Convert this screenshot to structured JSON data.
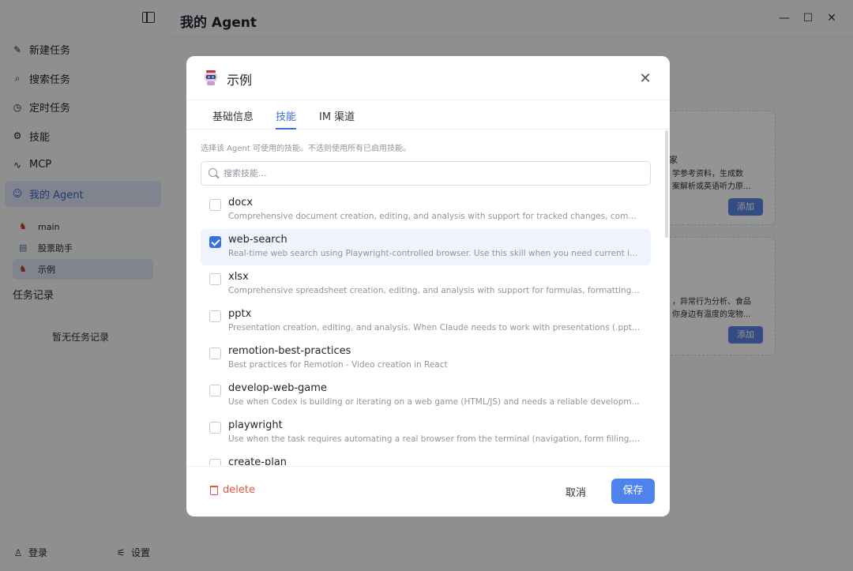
{
  "app": {
    "main_title": "我的 Agent",
    "window_controls": [
      "—",
      "☐",
      "✕"
    ]
  },
  "sidebar": {
    "items": [
      {
        "label": "新建任务",
        "icon": "edit-icon"
      },
      {
        "label": "搜索任务",
        "icon": "search-icon"
      },
      {
        "label": "定时任务",
        "icon": "clock-icon"
      },
      {
        "label": "技能",
        "icon": "puzzle-icon"
      },
      {
        "label": "MCP",
        "icon": "mcp-icon"
      },
      {
        "label": "我的 Agent",
        "icon": "agent-icon",
        "active": true
      }
    ],
    "agents": [
      {
        "label": "main",
        "icon": "lobster-icon"
      },
      {
        "label": "股票助手",
        "icon": "chart-icon"
      },
      {
        "label": "示例",
        "icon": "lobster-icon",
        "active": true
      }
    ],
    "task_section": "任务记录",
    "empty_tasks": "暂无任务记录",
    "login": "登录",
    "settings": "设置"
  },
  "background_cards": [
    {
      "title_fragment": "家",
      "lines": [
        "学参考资料，生成数",
        "案解析或英语听力原..."
      ],
      "button": "添加"
    },
    {
      "lines": [
        "，异常行为分析、食品",
        "你身边有温度的宠物..."
      ],
      "button": "添加"
    }
  ],
  "modal": {
    "title": "示例",
    "tabs": [
      {
        "label": "基础信息"
      },
      {
        "label": "技能",
        "active": true
      },
      {
        "label": "IM 渠道"
      }
    ],
    "hint": "选择该 Agent 可使用的技能。不选则使用所有已启用技能。",
    "search_placeholder": "搜索技能...",
    "skills": [
      {
        "name": "docx",
        "desc": "Comprehensive document creation, editing, and analysis with support for tracked changes, comm...",
        "checked": false
      },
      {
        "name": "web-search",
        "desc": "Real-time web search using Playwright-controlled browser. Use this skill when you need current in...",
        "checked": true
      },
      {
        "name": "xlsx",
        "desc": "Comprehensive spreadsheet creation, editing, and analysis with support for formulas, formatting, ...",
        "checked": false
      },
      {
        "name": "pptx",
        "desc": "Presentation creation, editing, and analysis. When Claude needs to work with presentations (.pptx ...",
        "checked": false
      },
      {
        "name": "remotion-best-practices",
        "desc": "Best practices for Remotion - Video creation in React",
        "checked": false
      },
      {
        "name": "develop-web-game",
        "desc": "Use when Codex is building or iterating on a web game (HTML/JS) and needs a reliable developm...",
        "checked": false
      },
      {
        "name": "playwright",
        "desc": "Use when the task requires automating a real browser from the terminal (navigation, form filling, s...",
        "checked": false
      },
      {
        "name": "create-plan",
        "desc": "",
        "checked": false
      }
    ],
    "delete_label": "delete",
    "cancel_label": "取消",
    "save_label": "保存"
  },
  "colors": {
    "accent": "#3a6fe0",
    "primary_button": "#4e82ed",
    "danger": "#e5533d",
    "overlay": "rgba(0,0,0,0.42)"
  }
}
